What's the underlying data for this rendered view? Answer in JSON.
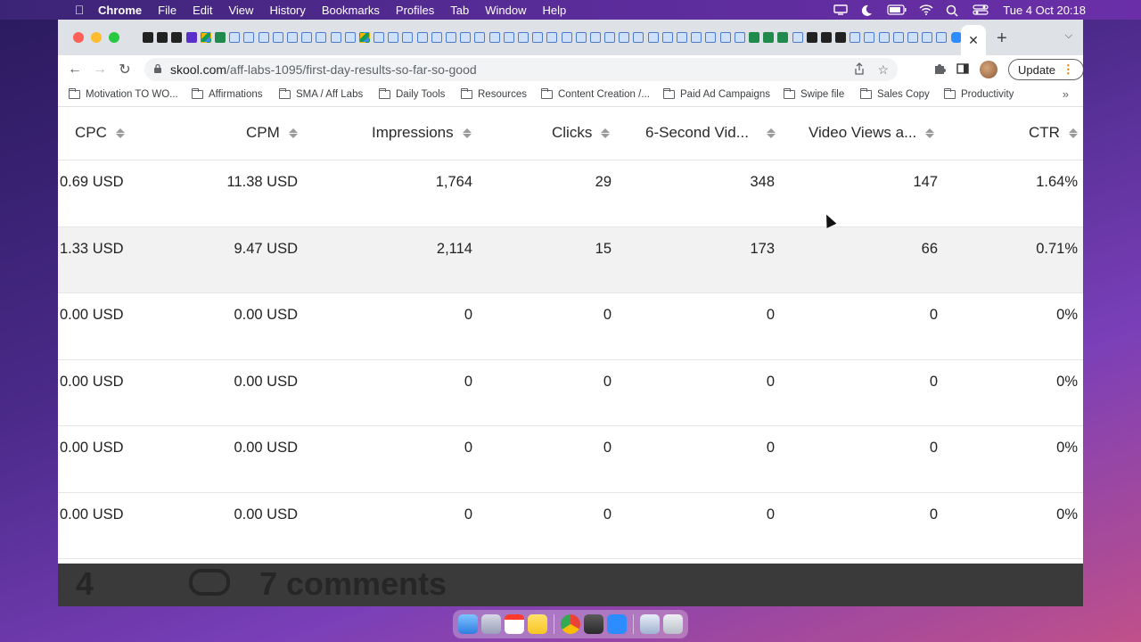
{
  "menubar": {
    "apple_icon": "apple-icon",
    "app_name": "Chrome",
    "menus": [
      "File",
      "Edit",
      "View",
      "History",
      "Bookmarks",
      "Profiles",
      "Tab",
      "Window",
      "Help"
    ],
    "clock": "Tue 4 Oct  20:18"
  },
  "browser": {
    "url_host": "skool.com",
    "url_path": "/aff-labs-1095/first-day-results-so-far-so-good",
    "update_label": "Update",
    "new_tab_icon": "+",
    "close_tab_icon": "✕"
  },
  "bookmarks": [
    "Motivation TO WO...",
    "Affirmations",
    "SMA / Aff Labs",
    "Daily Tools",
    "Resources",
    "Content Creation /...",
    "Paid Ad Campaigns",
    "Swipe file",
    "Sales Copy",
    "Productivity"
  ],
  "bookmarks_more": "»",
  "table": {
    "headers": [
      "CPC",
      "CPM",
      "Impressions",
      "Clicks",
      "6-Second Vid...",
      "Video Views a...",
      "CTR"
    ],
    "rows": [
      [
        "0.69 USD",
        "11.38 USD",
        "1,764",
        "29",
        "348",
        "147",
        "1.64%"
      ],
      [
        "1.33 USD",
        "9.47 USD",
        "2,114",
        "15",
        "173",
        "66",
        "0.71%"
      ],
      [
        "0.00 USD",
        "0.00 USD",
        "0",
        "0",
        "0",
        "0",
        "0%"
      ],
      [
        "0.00 USD",
        "0.00 USD",
        "0",
        "0",
        "0",
        "0",
        "0%"
      ],
      [
        "0.00 USD",
        "0.00 USD",
        "0",
        "0",
        "0",
        "0",
        "0%"
      ],
      [
        "0.00 USD",
        "0.00 USD",
        "0",
        "0",
        "0",
        "0",
        "0%"
      ]
    ]
  },
  "post_footer": {
    "likes_count": "4",
    "comments_label": "7 comments"
  }
}
